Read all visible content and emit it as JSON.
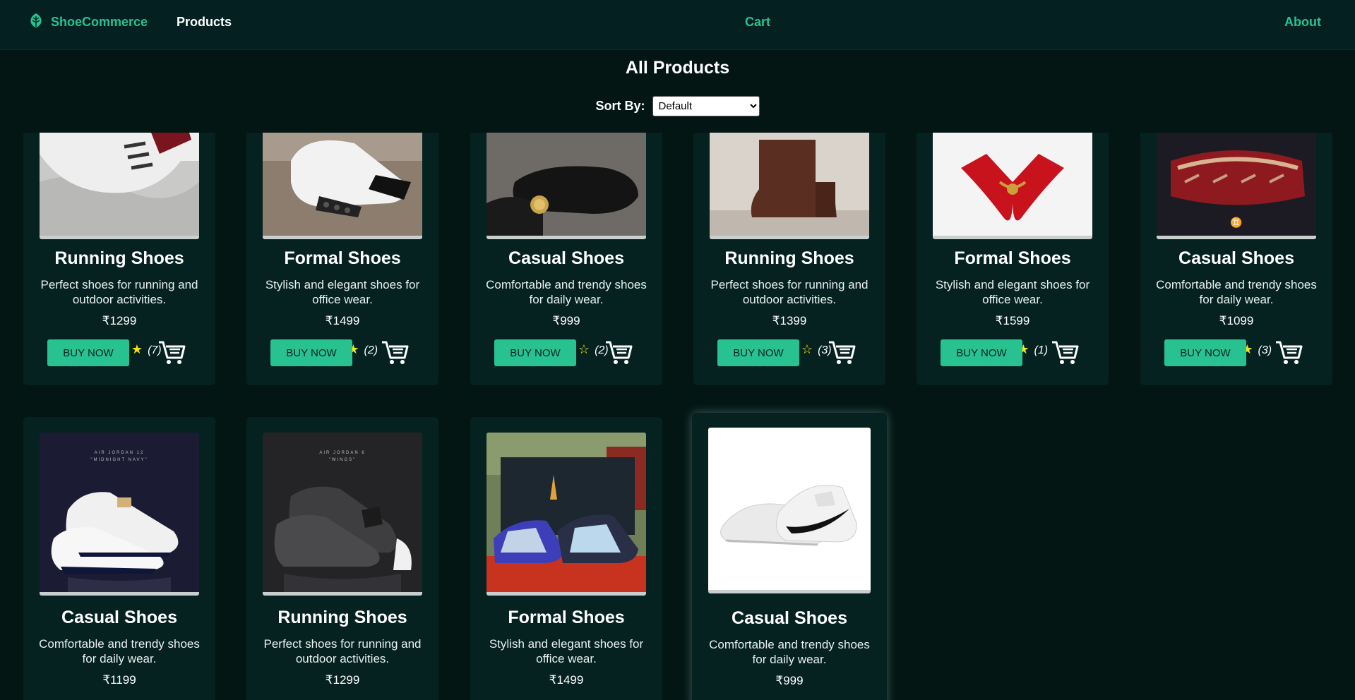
{
  "nav": {
    "brand": "ShoeCommerce",
    "brand_icon": "leaf-icon",
    "products": "Products",
    "cart": "Cart",
    "about": "About"
  },
  "page": {
    "title": "All Products",
    "sort_label": "Sort By:",
    "sort_value": "Default"
  },
  "buy_label": "BUY NOW",
  "colors": {
    "accent": "#27c290",
    "star": "#f5e30b",
    "card": "#052220",
    "background": "#031614"
  },
  "products": [
    {
      "name": "Running Shoes",
      "desc": "Perfect shoes for running and outdoor activities.",
      "price": "₹1299",
      "stars": "★★★★★",
      "count": "(7)",
      "image": "white-red-sneaker-on-marble"
    },
    {
      "name": "Formal Shoes",
      "desc": "Stylish and elegant shoes for office wear.",
      "price": "₹1499",
      "stars": "★★★★",
      "count": "(2)",
      "image": "white-black-sneaker"
    },
    {
      "name": "Casual Shoes",
      "desc": "Comfortable and trendy shoes for daily wear.",
      "price": "₹999",
      "stars": "★★★★☆",
      "count": "(2)",
      "image": "black-loafer-with-gold-watch"
    },
    {
      "name": "Running Shoes",
      "desc": "Perfect shoes for running and outdoor activities.",
      "price": "₹1399",
      "stars": "★★★★☆",
      "count": "(3)",
      "image": "brown-heeled-boot"
    },
    {
      "name": "Formal Shoes",
      "desc": "Stylish and elegant shoes for office wear.",
      "price": "₹1599",
      "stars": "★★★★",
      "count": "(1)",
      "image": "red-heels-with-gold-bow"
    },
    {
      "name": "Casual Shoes",
      "desc": "Comfortable and trendy shoes for daily wear.",
      "price": "₹1099",
      "stars": "★★★★",
      "count": "(3)",
      "image": "red-sneaker-sole"
    },
    {
      "name": "Casual Shoes",
      "desc": "Comfortable and trendy shoes for daily wear.",
      "price": "₹1199",
      "image": "air-jordan-12-midnight-navy",
      "caption_top": "AIR JORDAN 12",
      "caption_sub": "\"MIDNIGHT NAVY\""
    },
    {
      "name": "Running Shoes",
      "desc": "Perfect shoes for running and outdoor activities.",
      "price": "₹1299",
      "image": "air-jordan-6-wings",
      "caption_top": "AIR JORDAN 6",
      "caption_sub": "\"WINGS\""
    },
    {
      "name": "Formal Shoes",
      "desc": "Stylish and elegant shoes for office wear.",
      "price": "₹1499",
      "image": "jordan-1-mid-with-box"
    },
    {
      "name": "Casual Shoes",
      "desc": "Comfortable and trendy shoes for daily wear.",
      "price": "₹999",
      "image": "white-nike-sneaker"
    }
  ]
}
